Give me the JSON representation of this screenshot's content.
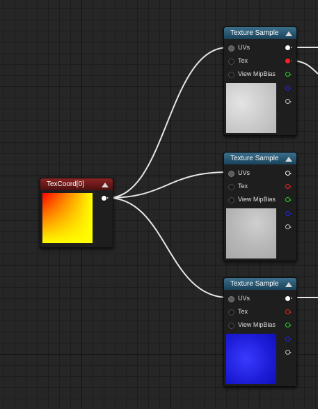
{
  "nodes": {
    "texcoord": {
      "title": "TexCoord[0]"
    },
    "texsample1": {
      "title": "Texture Sample",
      "inputs": [
        "UVs",
        "Tex",
        "View MipBias"
      ]
    },
    "texsample2": {
      "title": "Texture Sample",
      "inputs": [
        "UVs",
        "Tex",
        "View MipBias"
      ]
    },
    "texsample3": {
      "title": "Texture Sample",
      "inputs": [
        "UVs",
        "Tex",
        "View MipBias"
      ]
    }
  },
  "pin_colors": {
    "rgb": "#ffffff",
    "r": "#ff2020",
    "g": "#22dd22",
    "b": "#2222ff",
    "a": "#c8c8c8"
  }
}
